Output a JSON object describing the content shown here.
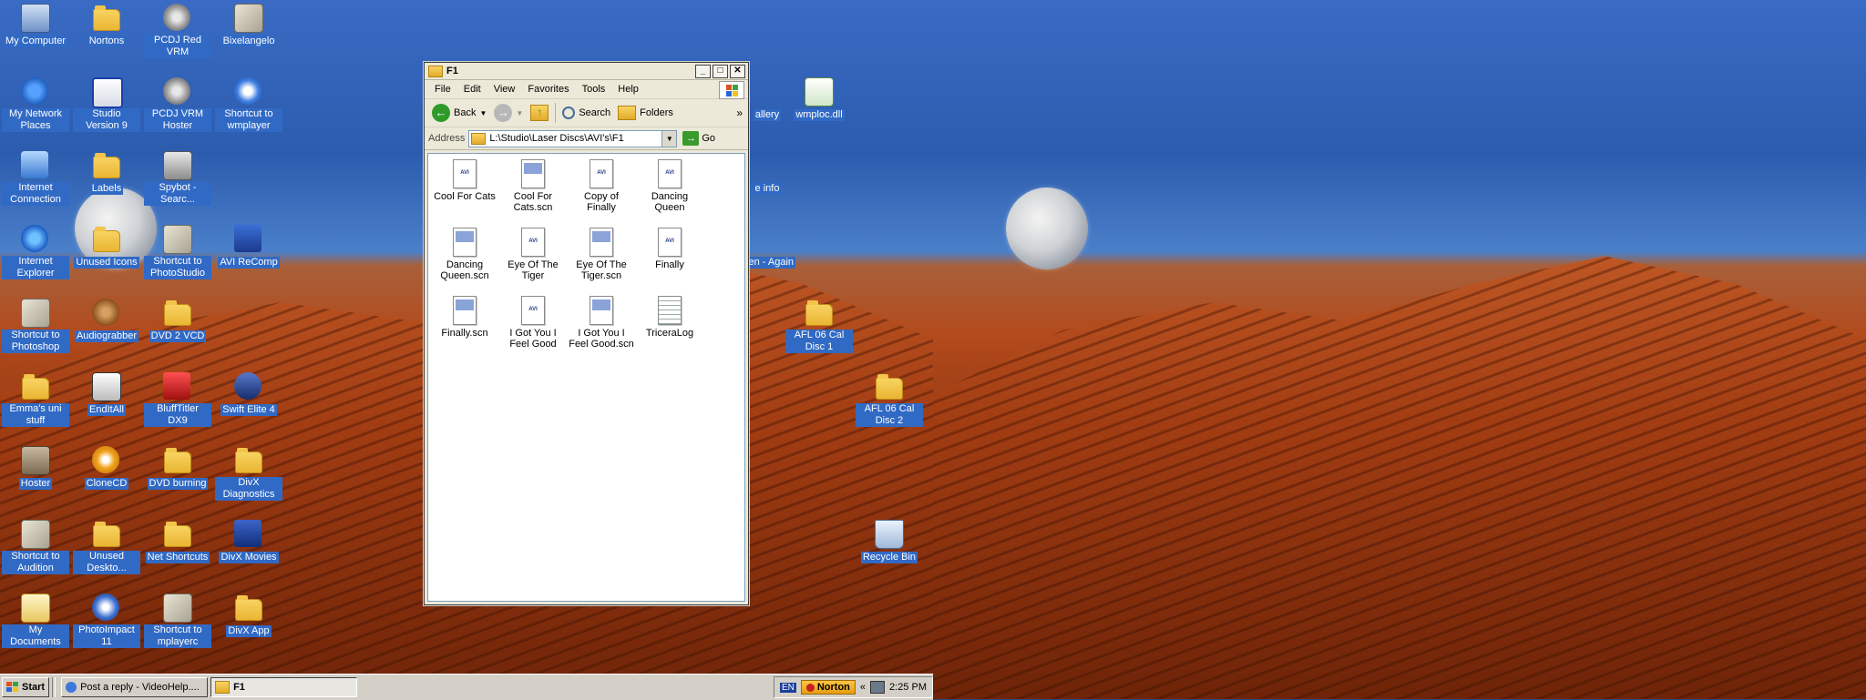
{
  "desktop_icons": [
    {
      "label": "My Computer",
      "kind": "computer-icon"
    },
    {
      "label": "Nortons",
      "kind": "folder-icon"
    },
    {
      "label": "PCDJ Red VRM",
      "kind": "pcdj-icon"
    },
    {
      "label": "Bixelangelo",
      "kind": "shortcut-icon"
    },
    {
      "label": "My Network Places",
      "kind": "network-icon"
    },
    {
      "label": "Studio Version 9",
      "kind": "studio-icon"
    },
    {
      "label": "PCDJ VRM Hoster",
      "kind": "pcdj-icon"
    },
    {
      "label": "Shortcut to wmplayer",
      "kind": "wmplayer-icon"
    },
    {
      "label": "Internet Connection",
      "kind": "connection-icon"
    },
    {
      "label": "Labels",
      "kind": "folder-icon"
    },
    {
      "label": "Spybot - Searc...",
      "kind": "spybot-icon"
    },
    {
      "label": "Internet Explorer",
      "kind": "ie-icon"
    },
    {
      "label": "Unused Icons",
      "kind": "folder-icon"
    },
    {
      "label": "Shortcut to PhotoStudio",
      "kind": "shortcut-icon"
    },
    {
      "label": "AVI ReComp",
      "kind": "avirecomp-icon"
    },
    {
      "label": "Shortcut to Photoshop",
      "kind": "shortcut-icon"
    },
    {
      "label": "Audiograbber",
      "kind": "audiograbber-icon"
    },
    {
      "label": "DVD 2 VCD",
      "kind": "folder-icon"
    },
    {
      "label": "Emma's uni stuff",
      "kind": "folder-icon"
    },
    {
      "label": "EndItAll",
      "kind": "enditall-icon"
    },
    {
      "label": "BluffTitler DX9",
      "kind": "blufftitler-icon"
    },
    {
      "label": "Swift Elite 4",
      "kind": "swift-icon"
    },
    {
      "label": "Hoster",
      "kind": "hoster-icon"
    },
    {
      "label": "CloneCD",
      "kind": "clonecd-icon"
    },
    {
      "label": "DVD burning",
      "kind": "folder-icon"
    },
    {
      "label": "DivX Diagnostics",
      "kind": "folder-icon"
    },
    {
      "label": "Shortcut to Audition",
      "kind": "shortcut-icon"
    },
    {
      "label": "Unused Deskto...",
      "kind": "folder-icon"
    },
    {
      "label": "Net Shortcuts",
      "kind": "folder-icon"
    },
    {
      "label": "DivX Movies",
      "kind": "divx-icon"
    },
    {
      "label": "My Documents",
      "kind": "documents-icon"
    },
    {
      "label": "PhotoImpact 11",
      "kind": "photoimpact-icon"
    },
    {
      "label": "Shortcut to mplayerc",
      "kind": "shortcut-icon"
    },
    {
      "label": "DivX App",
      "kind": "folder-icon"
    },
    {
      "label": "allery",
      "kind": "partial-icon"
    },
    {
      "label": "wmploc.dll",
      "kind": "dll-icon"
    },
    {
      "label": "e info",
      "kind": "partial-icon"
    },
    {
      "label": "itten - Again",
      "kind": "partial-icon"
    },
    {
      "label": "AFL 06 Cal Disc 1",
      "kind": "folder-icon"
    },
    {
      "label": "AFL 06 Cal Disc 2",
      "kind": "folder-icon"
    },
    {
      "label": "Recycle Bin",
      "kind": "recycle-bin-icon"
    }
  ],
  "window": {
    "title": "F1",
    "menu": [
      "File",
      "Edit",
      "View",
      "Favorites",
      "Tools",
      "Help"
    ],
    "toolbar": {
      "back": "Back",
      "search": "Search",
      "folders": "Folders",
      "more": "»"
    },
    "address_label": "Address",
    "address_value": "L:\\Studio\\Laser Discs\\AVI's\\F1",
    "go_label": "Go",
    "files": [
      {
        "name": "Cool For Cats",
        "type": "AVI"
      },
      {
        "name": "Cool For Cats.scn",
        "type": "scn"
      },
      {
        "name": "Copy of Finally",
        "type": "AVI"
      },
      {
        "name": "Dancing Queen",
        "type": "AVI"
      },
      {
        "name": "Dancing Queen.scn",
        "type": "scn"
      },
      {
        "name": "Eye Of The Tiger",
        "type": "AVI"
      },
      {
        "name": "Eye Of The Tiger.scn",
        "type": "scn"
      },
      {
        "name": "Finally",
        "type": "AVI"
      },
      {
        "name": "Finally.scn",
        "type": "scn"
      },
      {
        "name": "I Got You I Feel Good",
        "type": "AVI"
      },
      {
        "name": "I Got You I Feel Good.scn",
        "type": "scn"
      },
      {
        "name": "TriceraLog",
        "type": "txt"
      }
    ]
  },
  "taskbar": {
    "start": "Start",
    "tasks": [
      {
        "label": "Post a reply - VideoHelp....",
        "active": false
      },
      {
        "label": "F1",
        "active": true
      }
    ],
    "tray": {
      "lang": "EN",
      "norton": "Norton",
      "chevron": "«",
      "clock": "2:25 PM"
    }
  },
  "colors": {
    "selection": "#316ac5",
    "window_face": "#ece9d8",
    "taskbar": "#d4d0c8",
    "sky": "#2c5cae",
    "sand": "#a23d13"
  }
}
